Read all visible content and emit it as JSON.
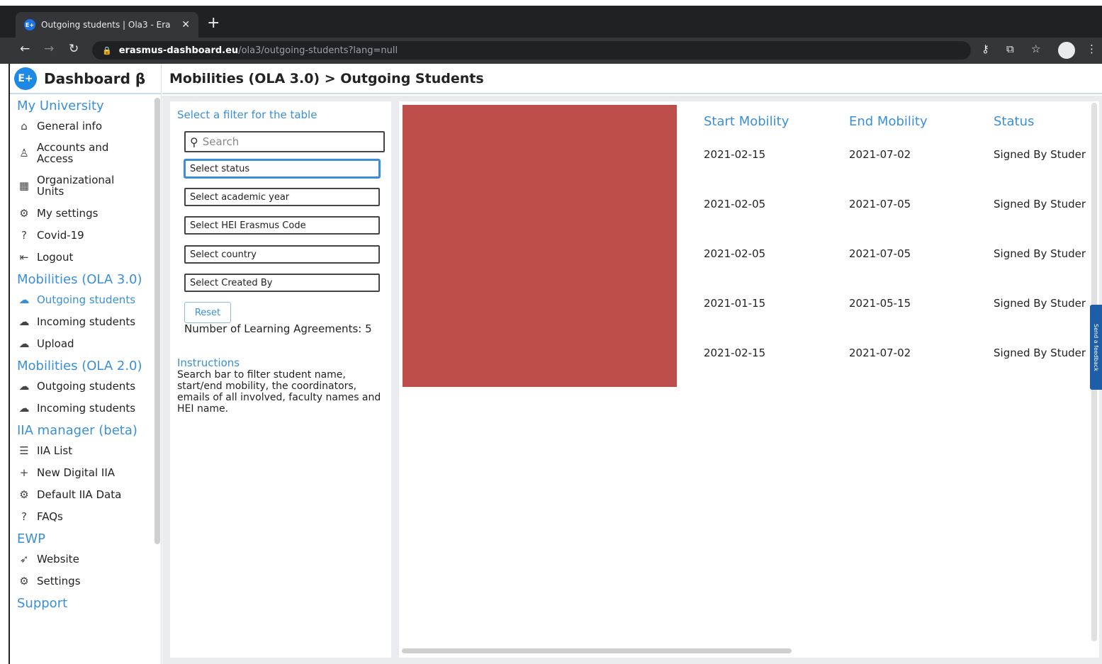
{
  "browser": {
    "tab_title": "Outgoing students | Ola3 - Era",
    "favicon_text": "E+",
    "url_host": "erasmus-dashboard.eu",
    "url_path": "/ola3/outgoing-students?lang=null"
  },
  "brand": {
    "logo_text": "E+",
    "title": "Dashboard β"
  },
  "sidebar": {
    "sections": [
      {
        "title": "My University",
        "items": [
          {
            "label": "General info",
            "icon": "home-icon"
          },
          {
            "label": "Accounts and Access",
            "icon": "user-icon"
          },
          {
            "label": "Organizational Units",
            "icon": "org-units-icon"
          },
          {
            "label": "My settings",
            "icon": "gear-icon"
          },
          {
            "label": "Covid-19",
            "icon": "question-icon"
          },
          {
            "label": "Logout",
            "icon": "logout-icon"
          }
        ]
      },
      {
        "title": "Mobilities (OLA 3.0)",
        "items": [
          {
            "label": "Outgoing students",
            "icon": "cloud-icon",
            "active": true
          },
          {
            "label": "Incoming students",
            "icon": "cloud-icon"
          },
          {
            "label": "Upload",
            "icon": "cloud-icon"
          }
        ]
      },
      {
        "title": "Mobilities (OLA 2.0)",
        "items": [
          {
            "label": "Outgoing students",
            "icon": "cloud-icon"
          },
          {
            "label": "Incoming students",
            "icon": "cloud-icon"
          }
        ]
      },
      {
        "title": "IIA manager (beta)",
        "items": [
          {
            "label": "IIA List",
            "icon": "list-icon"
          },
          {
            "label": "New Digital IIA",
            "icon": "plus-icon"
          },
          {
            "label": "Default IIA Data",
            "icon": "gear-icon"
          },
          {
            "label": "FAQs",
            "icon": "question-icon"
          }
        ]
      },
      {
        "title": "EWP",
        "items": [
          {
            "label": "Website",
            "icon": "send-icon"
          },
          {
            "label": "Settings",
            "icon": "gear-icon"
          }
        ]
      },
      {
        "title": "Support",
        "items": []
      }
    ]
  },
  "header": {
    "title": "Mobilities (OLA 3.0) > Outgoing Students"
  },
  "filters": {
    "heading": "Select a filter for the table",
    "search_placeholder": "Search",
    "status": "Select status",
    "academic_year": "Select academic year",
    "hei_code": "Select HEI Erasmus Code",
    "country": "Select country",
    "created_by": "Select Created By",
    "reset_label": "Reset",
    "la_count_text": "Number of Learning Agreements: 5",
    "instructions_title": "Instructions",
    "instructions_text": "Search bar to filter student name, start/end mobility, the coordinators, emails of all involved, faculty names and HEI name."
  },
  "table": {
    "columns": [
      "Start Mobility",
      "End Mobility",
      "Status"
    ],
    "rows": [
      {
        "start": "2021-02-15",
        "end": "2021-07-02",
        "status": "Signed By Studer"
      },
      {
        "start": "2021-02-05",
        "end": "2021-07-05",
        "status": "Signed By Studer"
      },
      {
        "start": "2021-02-05",
        "end": "2021-07-05",
        "status": "Signed By Studer"
      },
      {
        "start": "2021-01-15",
        "end": "2021-05-15",
        "status": "Signed By Studer"
      },
      {
        "start": "2021-02-15",
        "end": "2021-07-02",
        "status": "Signed By Studer"
      }
    ],
    "redacted_color": "#bd4d4b"
  },
  "feedback_tab": "Send a feedback",
  "colors": {
    "accent": "#3a8fd8",
    "chrome": "#202124"
  }
}
